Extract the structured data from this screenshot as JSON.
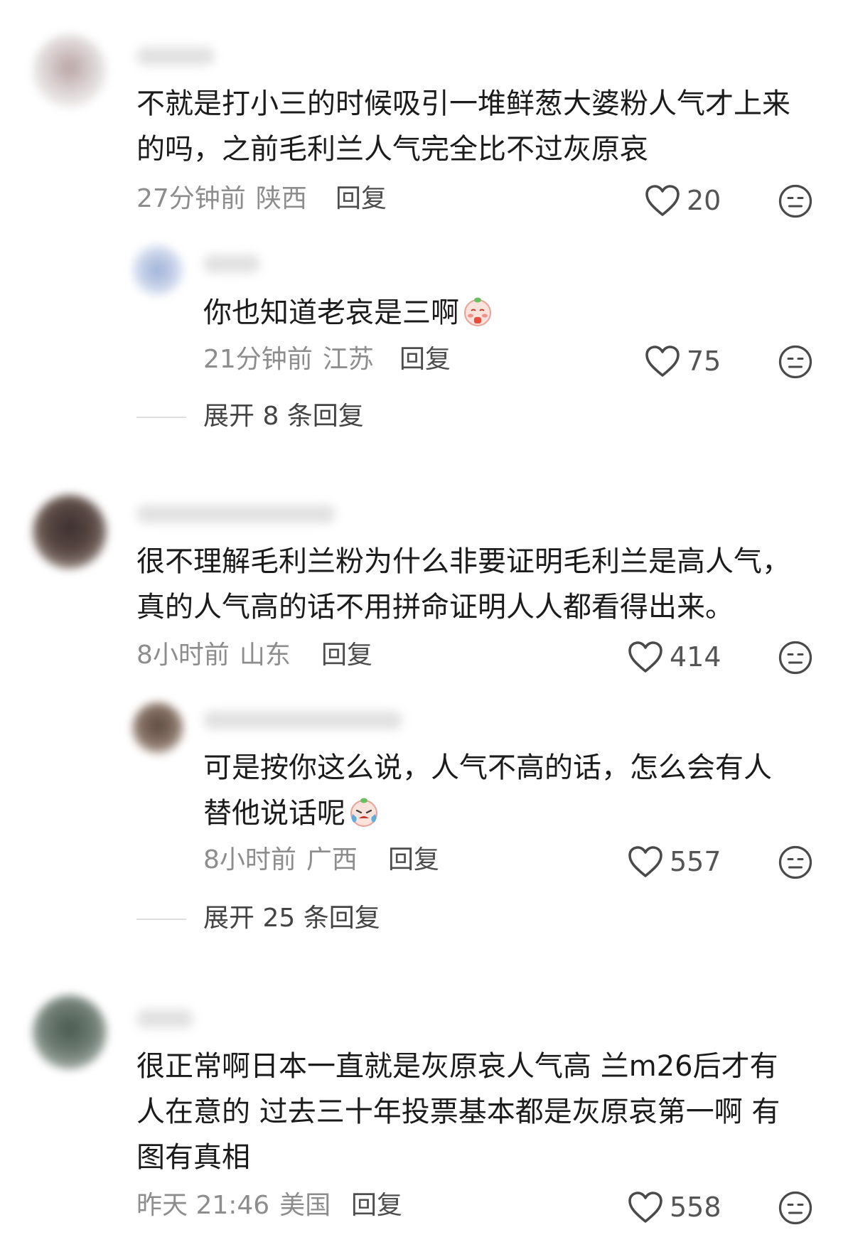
{
  "comments": [
    {
      "text_lines": [
        "不就是打小三的时候吸引一堆鲜葱大婆粉人气才上来",
        "的吗，之前毛利兰人气完全比不过灰原哀"
      ],
      "time": "27分钟前",
      "location": "陕西",
      "reply_label": "回复",
      "likes": "20",
      "replies": [
        {
          "text_lines": [
            "你也知道老哀是三啊"
          ],
          "emoji": "blushing-cartoon-emoji",
          "time": "21分钟前",
          "location": "江苏",
          "reply_label": "回复",
          "likes": "75"
        }
      ],
      "expand_label": "展开 8 条回复"
    },
    {
      "text_lines": [
        "很不理解毛利兰粉为什么非要证明毛利兰是高人气，",
        "真的人气高的话不用拼命证明人人都看得出来。"
      ],
      "time": "8小时前",
      "location": "山东",
      "reply_label": "回复",
      "likes": "414",
      "replies": [
        {
          "text_lines": [
            "可是按你这么说，人气不高的话，怎么会有人",
            "替他说话呢"
          ],
          "emoji": "crying-cartoon-emoji",
          "time": "8小时前",
          "location": "广西",
          "reply_label": "回复",
          "likes": "557"
        }
      ],
      "expand_label": "展开 25 条回复"
    },
    {
      "text_lines": [
        "很正常啊日本一直就是灰原哀人气高 兰m26后才有",
        "人在意的 过去三十年投票基本都是灰原哀第一啊 有",
        "图有真相"
      ],
      "time": "昨天 21:46",
      "location": "美国",
      "reply_label": "回复",
      "likes": "558"
    }
  ],
  "icons": {
    "like": "heart-outline-icon",
    "dislike": "unamused-face-icon"
  },
  "colors": {
    "text": "#1b1b1b",
    "meta": "#8d8d8d",
    "icon": "#4a4a4a"
  }
}
